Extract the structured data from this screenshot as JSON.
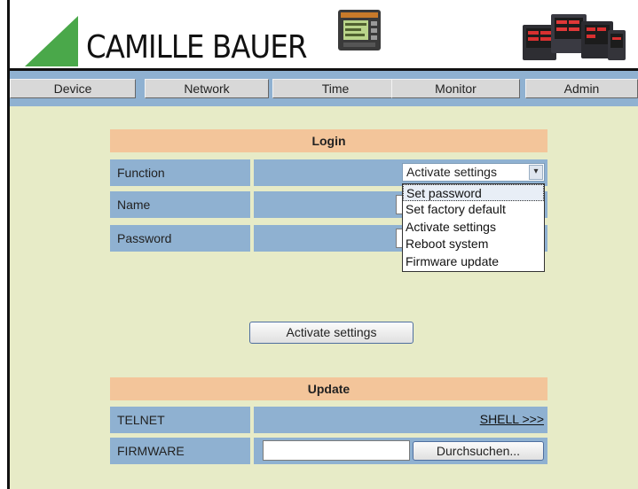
{
  "brand": {
    "name": "CAMILLE BAUER",
    "triangle_color": "#4aa84a"
  },
  "nav": {
    "items": [
      {
        "label": "Device"
      },
      {
        "label": "Network"
      },
      {
        "label": "Time"
      },
      {
        "label": "Monitor"
      },
      {
        "label": "Admin"
      }
    ]
  },
  "login": {
    "title": "Login",
    "function_label": "Function",
    "function_selected": "Activate settings",
    "name_label": "Name",
    "password_label": "Password",
    "options": [
      "Set password",
      "Set factory default",
      "Activate settings",
      "Reboot system",
      "Firmware update"
    ],
    "highlighted_option": "Set password",
    "submit_label": "Activate settings"
  },
  "update": {
    "title": "Update",
    "telnet_label": "TELNET",
    "telnet_link": "SHELL >>>",
    "firmware_label": "FIRMWARE",
    "browse_label": "Durchsuchen..."
  },
  "colors": {
    "nav_bg": "#8fb1d1",
    "content_bg": "#e7ebc7",
    "section_head": "#f3c59a",
    "cell_bg": "#8fb1d1"
  }
}
